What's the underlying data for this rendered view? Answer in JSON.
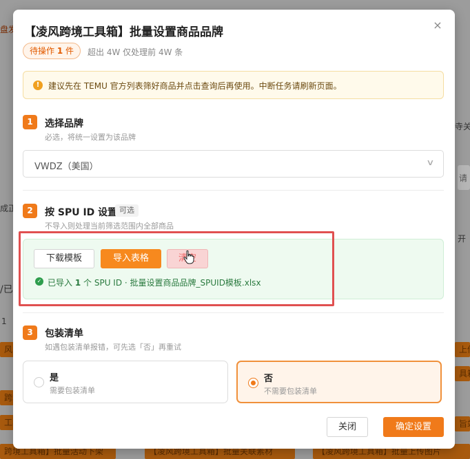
{
  "background": {
    "top_left": "盘发",
    "right_1": "寺关注",
    "right_2": "请",
    "right_3": "开",
    "left_1": "成正",
    "left_2": "/已",
    "left_3": "1",
    "strip_left_1": "风",
    "strip_left_2": "跨境",
    "strip_left_3": "工具",
    "strip_right_1": "具箱",
    "strip_right_2": "上传",
    "strip_right_3": "旨站",
    "bottom_1": "跨境工具箱】批量活动下架",
    "bottom_2": "【凌风跨境工具箱】批量关联素材",
    "bottom_3": "【凌风跨境工具箱】批量上传图片"
  },
  "modal": {
    "title": "【凌风跨境工具箱】批量设置商品品牌",
    "close_icon": "×",
    "pending_label": "待操作",
    "pending_count": "1",
    "pending_unit": "件",
    "limit_note": "超出 4W 仅处理前 4W 条",
    "alert_icon": "!",
    "alert_text": "建议先在 TEMU 官方列表筛好商品并点击查询后再使用。中断任务请刷新页面。",
    "step1": {
      "num": "1",
      "title": "选择品牌",
      "desc": "必选，将统一设置为该品牌",
      "selected": "VWDZ（美国）",
      "chevron": "∨"
    },
    "step2": {
      "num": "2",
      "title": "按 SPU ID 设置",
      "tag": "可选",
      "desc": "不导入则处理当前筛选范围内全部商品",
      "download_btn": "下载模板",
      "import_btn": "导入表格",
      "clear_btn": "清空",
      "ok_icon": "✓",
      "result_prefix": "已导入",
      "result_count": "1",
      "result_suffix": "个 SPU ID · 批量设置商品品牌_SPUID模板.xlsx"
    },
    "step3": {
      "num": "3",
      "title": "包装清单",
      "desc": "如遇包装清单报错，可先选「否」再重试",
      "yes_label": "是",
      "yes_sub": "需要包装清单",
      "no_label": "否",
      "no_sub": "不需要包装清单",
      "selected": "否"
    },
    "close_btn": "关闭",
    "confirm_btn": "确定设置"
  },
  "colors": {
    "accent": "#f07a1a",
    "success": "#2e9d4d",
    "danger_outline": "#e05050"
  }
}
